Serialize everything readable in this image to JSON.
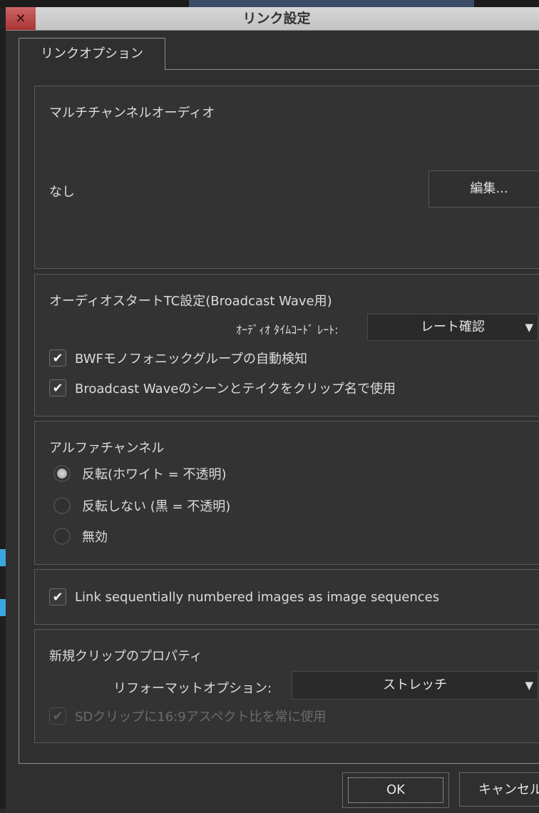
{
  "window": {
    "title": "リンク設定"
  },
  "tabs": [
    {
      "label": "リンクオプション",
      "active": true
    }
  ],
  "multichannel_audio": {
    "heading": "マルチチャンネルオーディオ",
    "value": "なし",
    "edit_button": "編集..."
  },
  "audio_start_tc": {
    "heading": "オーディオスタートTC設定(Broadcast Wave用)",
    "timecode_rate_label": "ｵｰﾃﾞｨｵ ﾀｲﾑｺｰﾄﾞ ﾚｰﾄ:",
    "timecode_rate_value": "レート確認",
    "checkboxes": [
      {
        "label": "BWFモノフォニックグループの自動検知",
        "checked": true
      },
      {
        "label": "Broadcast Waveのシーンとテイクをクリップ名で使用",
        "checked": true
      }
    ]
  },
  "alpha_channel": {
    "heading": "アルファチャンネル",
    "options": [
      {
        "label": "反転(ホワイト = 不透明)",
        "selected": true
      },
      {
        "label": "反転しない (黒 = 不透明)",
        "selected": false
      },
      {
        "label": "無効",
        "selected": false
      }
    ]
  },
  "image_sequence": {
    "checkbox": {
      "label": "Link sequentially numbered images as image sequences",
      "checked": true
    }
  },
  "new_clip_properties": {
    "heading": "新規クリップのプロパティ",
    "reformat_label": "リフォーマットオプション:",
    "reformat_value": "ストレッチ",
    "sd_aspect_checkbox": {
      "label": "SDクリップに16:9アスペクト比を常に使用",
      "checked": true,
      "disabled": true
    }
  },
  "footer": {
    "ok_label": "OK",
    "cancel_label": "キャンセル"
  },
  "icons": {
    "close": "close-icon",
    "check": "checkmark-icon",
    "dropdown": "triangle-down-icon"
  },
  "colors": {
    "title_bar": "#cfcfcf",
    "close_button": "#b04444",
    "panel": "#333333",
    "background": "#2f2f2f"
  }
}
